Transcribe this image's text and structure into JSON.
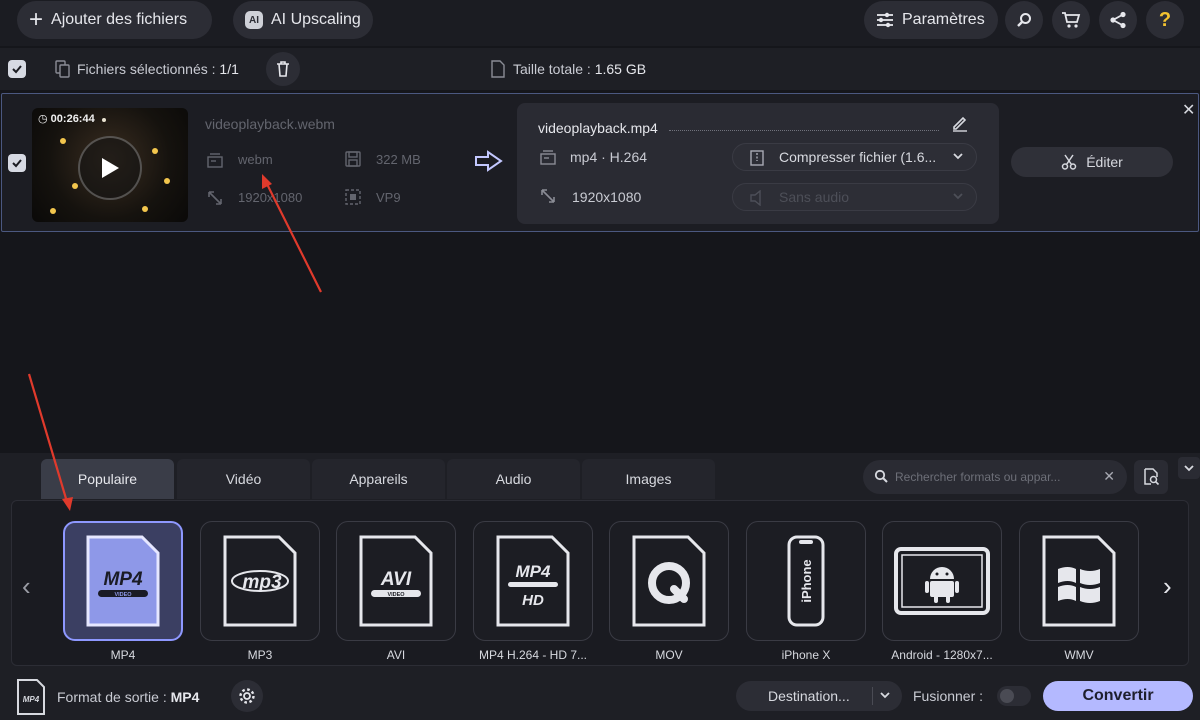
{
  "toolbar": {
    "add_files": "Ajouter des fichiers",
    "ai_upscaling": "AI Upscaling",
    "ai_badge": "AI",
    "settings": "Paramètres",
    "help": "?"
  },
  "selection": {
    "files_selected_label": "Fichiers sélectionnés :",
    "files_selected_value": "1/1",
    "total_size_label": "Taille totale :",
    "total_size_value": "1.65 GB"
  },
  "file": {
    "duration": "00:26:44",
    "source_name": "videoplayback.webm",
    "source_format": "webm",
    "source_size": "322 MB",
    "source_resolution": "1920x1080",
    "source_codec": "VP9",
    "target_name": "videoplayback.mp4",
    "target_format": "mp4 · H.264",
    "compress_label": "Compresser fichier (1.6...",
    "target_resolution": "1920x1080",
    "audio_label": "Sans audio",
    "edit_label": "Éditer"
  },
  "tabs": [
    {
      "label": "Populaire"
    },
    {
      "label": "Vidéo"
    },
    {
      "label": "Appareils"
    },
    {
      "label": "Audio"
    },
    {
      "label": "Images"
    }
  ],
  "search": {
    "placeholder": "Rechercher formats ou appar..."
  },
  "formats": [
    {
      "label": "MP4",
      "icon_text": "MP4",
      "icon_sub": "VIDEO"
    },
    {
      "label": "MP3",
      "icon_text": "mp3",
      "icon_sub": ""
    },
    {
      "label": "AVI",
      "icon_text": "AVI",
      "icon_sub": "VIDEO"
    },
    {
      "label": "MP4 H.264 - HD 7...",
      "icon_text": "MP4",
      "icon_sub": "HD"
    },
    {
      "label": "MOV",
      "icon_text": "",
      "icon_sub": ""
    },
    {
      "label": "iPhone X",
      "icon_text": "iPhone",
      "icon_sub": ""
    },
    {
      "label": "Android - 1280x7...",
      "icon_text": "",
      "icon_sub": ""
    },
    {
      "label": "WMV",
      "icon_text": "",
      "icon_sub": ""
    }
  ],
  "footer": {
    "output_format_label": "Format de sortie :",
    "output_format_value": "MP4",
    "format_icon_text": "MP4",
    "destination": "Destination...",
    "merge_label": "Fusionner :",
    "convert": "Convertir"
  },
  "colors": {
    "accent": "#b4b9ff",
    "active_tile": "#3b3f62",
    "annotation": "#e03a2c"
  }
}
